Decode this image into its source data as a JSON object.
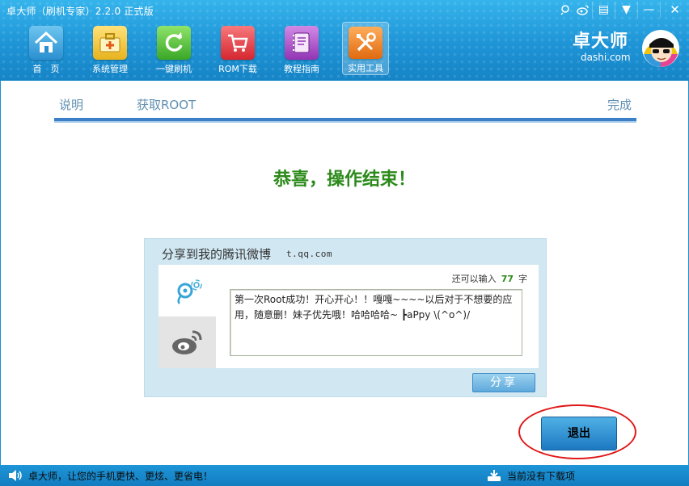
{
  "window": {
    "title": "卓大师（刷机专家）2.2.0 正式版",
    "controls": {
      "tqq_icon": "tencent-weibo-icon",
      "weibo_icon": "sina-weibo-icon",
      "menu": "▤",
      "dropdown": "▼",
      "minimize": "—",
      "close": "✕"
    }
  },
  "nav": {
    "items": [
      {
        "label": "首　页",
        "icon": "home-icon"
      },
      {
        "label": "系统管理",
        "icon": "toolbox-icon"
      },
      {
        "label": "一键刷机",
        "icon": "refresh-icon"
      },
      {
        "label": "ROM下载",
        "icon": "cart-icon"
      },
      {
        "label": "教程指南",
        "icon": "book-icon"
      },
      {
        "label": "实用工具",
        "icon": "tools-icon"
      }
    ],
    "active": "实用工具"
  },
  "brand": {
    "name_cn": "卓大师",
    "name_en": "dashi.com"
  },
  "steps": {
    "step1": "说明",
    "step2": "获取ROOT",
    "step3": "完成",
    "progress": 1.0
  },
  "result": {
    "message": "恭喜，操作结束！"
  },
  "share": {
    "title": "分享到我的腾讯微博",
    "site": "t.qq.com",
    "remain_prefix": "还可以输入",
    "remain_count": "77",
    "remain_suffix": "字",
    "text": "第一次Root成功！开心开心！！嘎嘎~~~~以后对于不想要的应用，随意删！妹子优先哦！哈哈哈哈~ ┣aPpy \\(^o^)/",
    "button": "分享"
  },
  "exit": {
    "label": "退出"
  },
  "footer": {
    "slogan": "卓大师，让您的手机更快、更炫、更省电！",
    "download_status": "当前没有下载项"
  },
  "colors": {
    "header": "#1e94d6",
    "success_text": "#2b8a1a",
    "highlight_ring": "#e01818",
    "progress": "#3a7fc8"
  }
}
